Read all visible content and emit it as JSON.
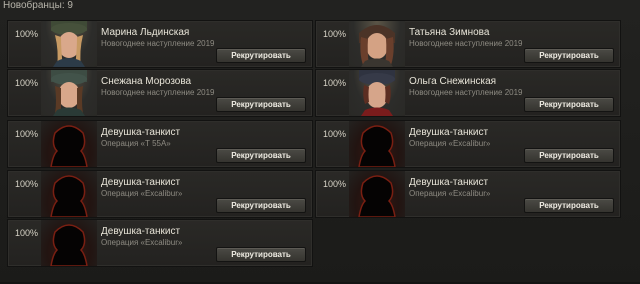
{
  "header": {
    "text": "Новобранцы: 9"
  },
  "recruit_label": "Рекрутировать",
  "cards": [
    {
      "pct": "100%",
      "name": "Марина Льдинская",
      "sub": "Новогоднее наступление 2019",
      "portrait": "female"
    },
    {
      "pct": "100%",
      "name": "Татьяна Зимнова",
      "sub": "Новогоднее наступление 2019",
      "portrait": "female"
    },
    {
      "pct": "100%",
      "name": "Снежана Морозова",
      "sub": "Новогоднее наступление 2019",
      "portrait": "female"
    },
    {
      "pct": "100%",
      "name": "Ольга Снежинская",
      "sub": "Новогоднее наступление 2019",
      "portrait": "female"
    },
    {
      "pct": "100%",
      "name": "Девушка-танкист",
      "sub": "Операция «Т 55А»",
      "portrait": "silhouette"
    },
    {
      "pct": "100%",
      "name": "Девушка-танкист",
      "sub": "Операция «Excalibur»",
      "portrait": "silhouette"
    },
    {
      "pct": "100%",
      "name": "Девушка-танкист",
      "sub": "Операция «Excalibur»",
      "portrait": "silhouette"
    },
    {
      "pct": "100%",
      "name": "Девушка-танкист",
      "sub": "Операция «Excalibur»",
      "portrait": "silhouette"
    },
    {
      "pct": "100%",
      "name": "Девушка-танкист",
      "sub": "Операция «Excalibur»",
      "portrait": "silhouette"
    }
  ]
}
